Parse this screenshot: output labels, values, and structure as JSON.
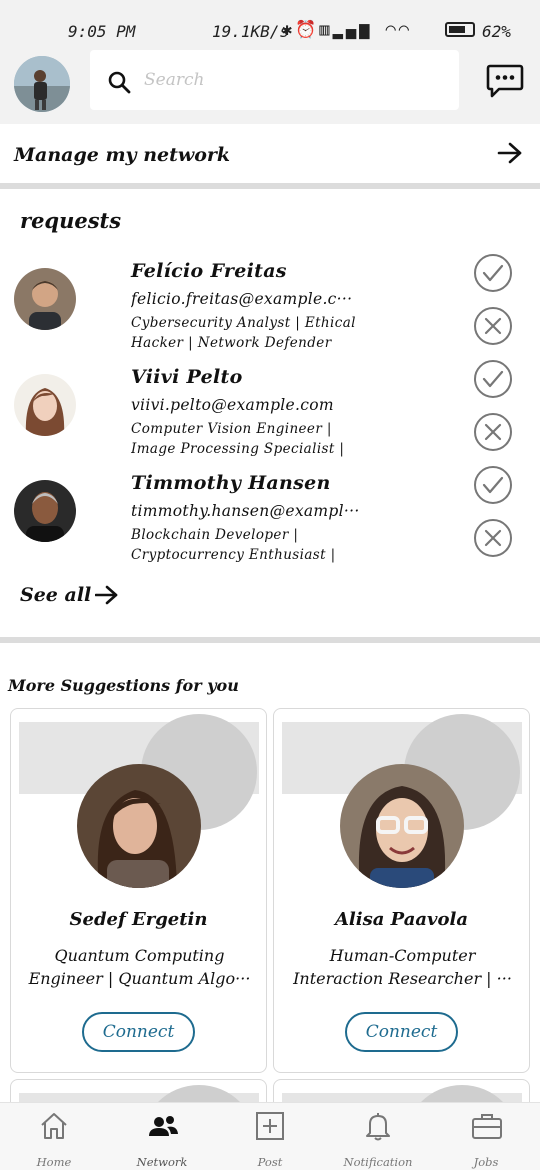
{
  "status_bar": {
    "time": "9:05 PM",
    "net_speed": "19.1KB/s",
    "battery": "62%"
  },
  "header": {
    "search_placeholder": "Search"
  },
  "manage": {
    "label": "Manage my network"
  },
  "requests": {
    "title": "requests",
    "items": [
      {
        "name": "Felício Freitas",
        "email": "felicio.freitas@example.c···",
        "title": "Cybersecurity Analyst | Ethical Hacker | Network Defender"
      },
      {
        "name": "Viivi Pelto",
        "email": "viivi.pelto@example.com",
        "title": "Computer Vision Engineer | Image Processing Specialist | Vi···"
      },
      {
        "name": "Timmothy Hansen",
        "email": "timmothy.hansen@exampl···",
        "title": "Blockchain Developer | Cryptocurrency Enthusiast | D···"
      }
    ],
    "see_all": "See all"
  },
  "suggestions": {
    "title": "More Suggestions for you",
    "cards": [
      {
        "name": "Sedef Ergetin",
        "title": "Quantum Computing Engineer | Quantum Algo···",
        "button": "Connect"
      },
      {
        "name": "Alisa Paavola",
        "title": "Human-Computer Interaction Researcher | ···",
        "button": "Connect"
      }
    ]
  },
  "bottom_nav": {
    "items": [
      {
        "label": "Home",
        "icon": "home-icon"
      },
      {
        "label": "Network",
        "icon": "network-icon"
      },
      {
        "label": "Post",
        "icon": "post-icon"
      },
      {
        "label": "Notification",
        "icon": "bell-icon"
      },
      {
        "label": "Jobs",
        "icon": "briefcase-icon"
      }
    ],
    "active": "Network"
  },
  "colors": {
    "accent": "#1e6b8f",
    "header_bg": "#f2f2f2",
    "divider": "#dcdcdc"
  }
}
